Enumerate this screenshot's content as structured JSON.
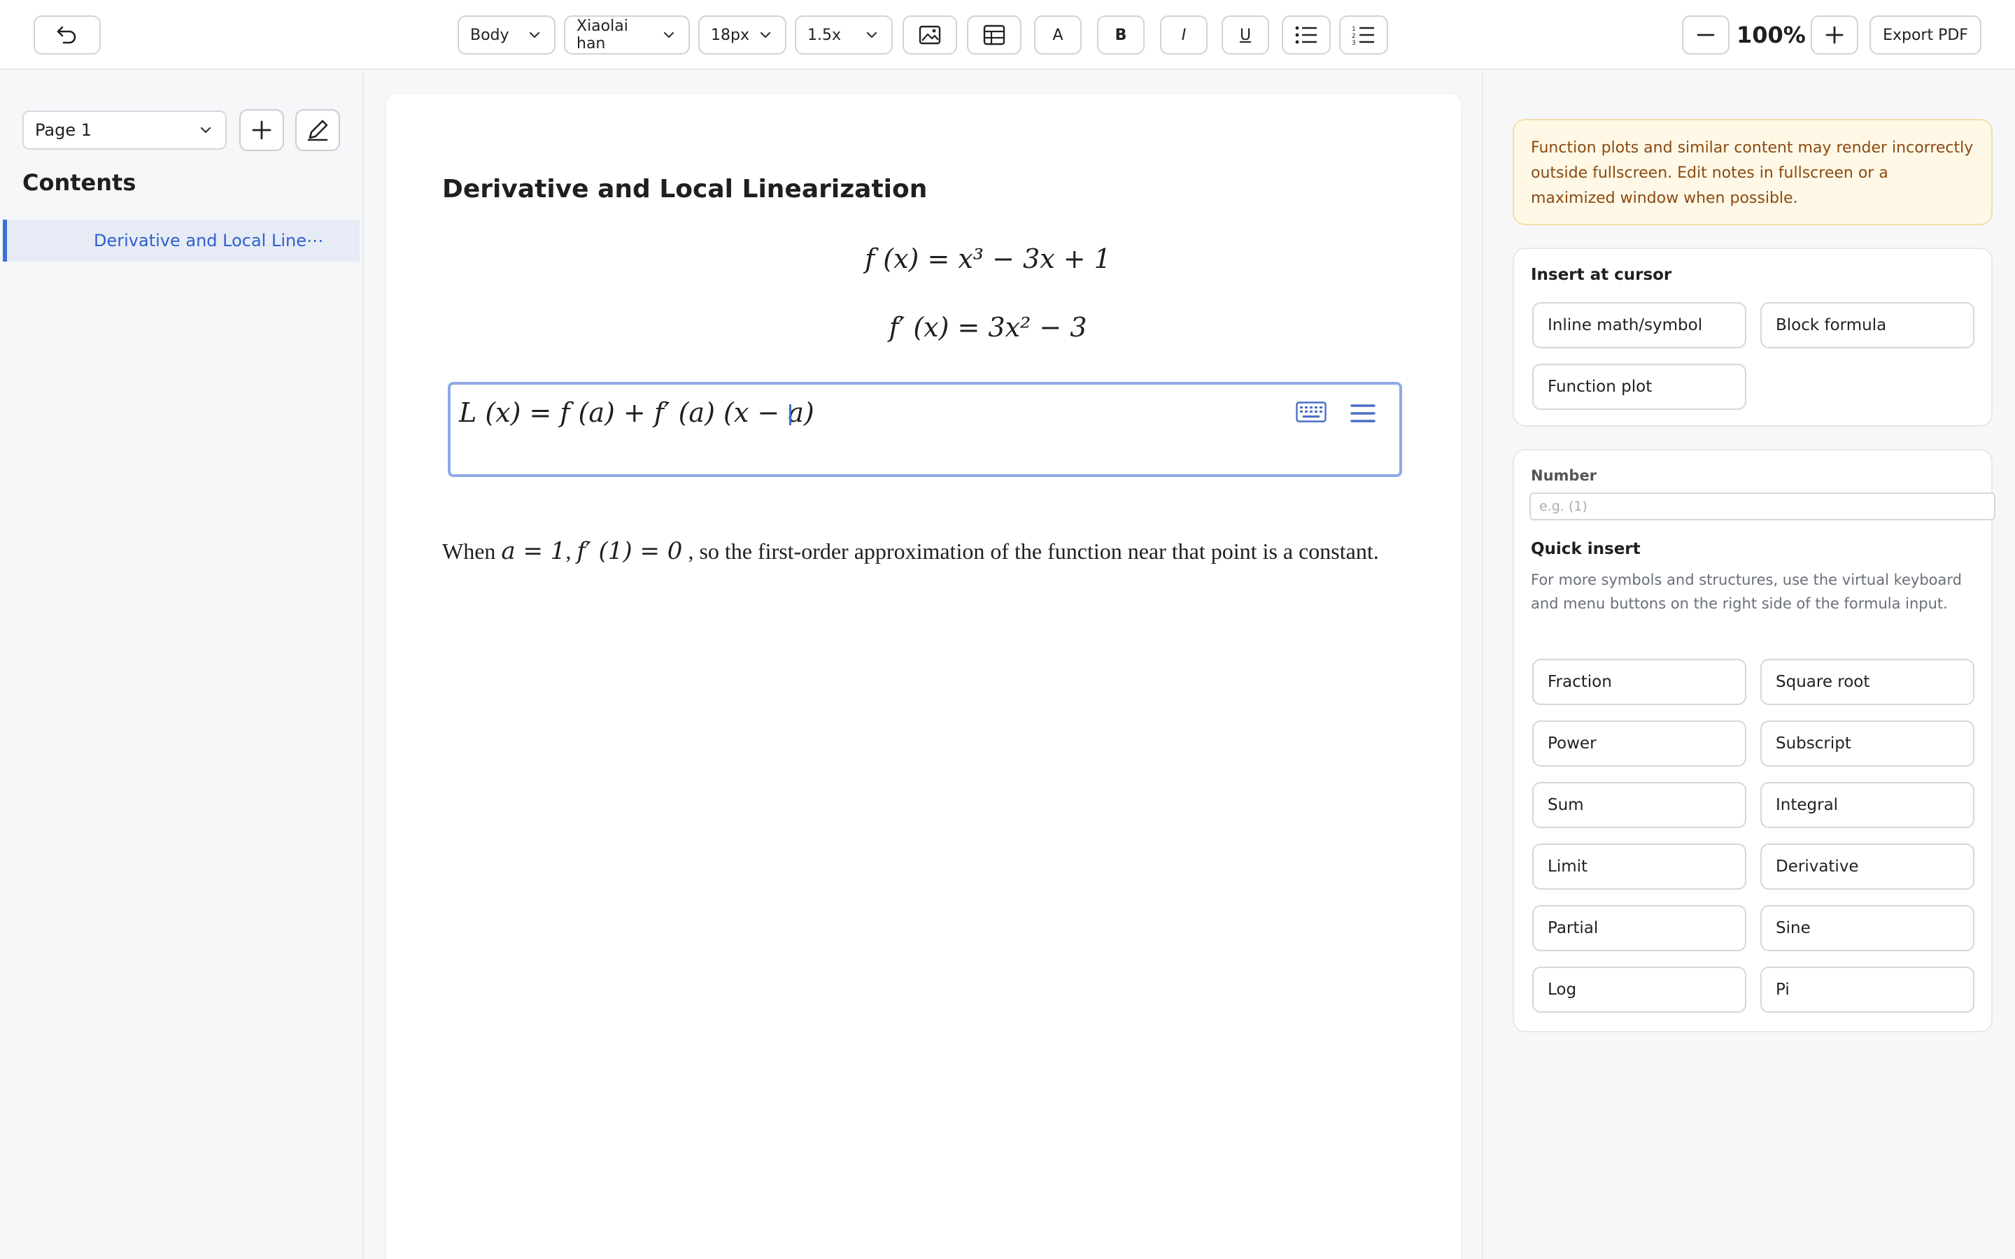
{
  "toolbar": {
    "style_select": "Body",
    "font_select": "Xiaolai han",
    "size_select": "18px",
    "line_height_select": "1.5x",
    "text_a_label": "A",
    "bold_label": "B",
    "italic_label": "I",
    "underline_label": "U",
    "zoom_value": "100%",
    "export_label": "Export PDF"
  },
  "sidebar": {
    "page_select": "Page 1",
    "contents_title": "Contents",
    "toc": [
      {
        "label": "Derivative and Local Line⋯"
      }
    ]
  },
  "document": {
    "title": "Derivative and Local Linearization",
    "equations": {
      "eq1": "f (x) = x³ − 3x + 1",
      "eq2": "f′ (x) = 3x² − 3",
      "eq3": "L (x) = f (a) + f′ (a) (x − a)"
    },
    "paragraph": {
      "when": "When",
      "math1": "a = 1",
      "comma": ",",
      "math2": "f′ (1) = 0",
      "rest": ", so the first-order approximation of the function near that point is a constant."
    }
  },
  "right_panel": {
    "warning": "Function plots and similar content may render incorrectly outside fullscreen. Edit notes in fullscreen or a maximized window when possible.",
    "insert_at_cursor": {
      "title": "Insert at cursor",
      "buttons": [
        "Inline math/symbol",
        "Block formula",
        "Function plot"
      ]
    },
    "number": {
      "label": "Number",
      "placeholder": "e.g. (1)"
    },
    "quick_insert": {
      "title": "Quick insert",
      "description": "For more symbols and structures, use the virtual keyboard and menu buttons on the right side of the formula input.",
      "buttons": [
        "Fraction",
        "Square root",
        "Power",
        "Subscript",
        "Sum",
        "Integral",
        "Limit",
        "Derivative",
        "Partial",
        "Sine",
        "Log",
        "Pi"
      ]
    }
  },
  "colors": {
    "accent": "#3b6fd8",
    "warning_bg": "#fff8e6",
    "warning_text": "#8a4a12",
    "active_border": "#8fa9e8"
  },
  "icons": [
    "undo-icon",
    "chevron-down-icon",
    "image-icon",
    "table-icon",
    "bullet-list-icon",
    "numbered-list-icon",
    "minus-icon",
    "plus-icon",
    "edit-pen-icon",
    "keyboard-icon",
    "menu-icon"
  ]
}
